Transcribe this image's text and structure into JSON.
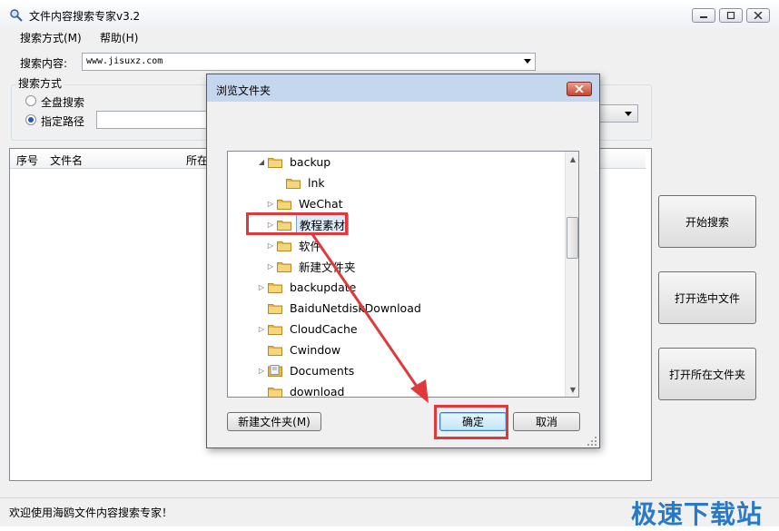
{
  "window": {
    "title": "文件内容搜索专家v3.2",
    "icon": "magnifier-icon"
  },
  "menu": {
    "items": [
      "搜索方式(M)",
      "帮助(H)"
    ]
  },
  "search": {
    "label": "搜索内容:",
    "value": "www.jisuxz.com"
  },
  "mode": {
    "group_title": "搜索方式",
    "options": [
      "全盘搜索",
      "指定路径"
    ],
    "selected": "指定路径"
  },
  "results": {
    "columns": [
      "序号",
      "文件名",
      "所在"
    ]
  },
  "buttons": {
    "start": "开始搜索",
    "open_file": "打开选中文件",
    "open_folder": "打开所在文件夹"
  },
  "status": {
    "text": "欢迎使用海鸥文件内容搜索专家！",
    "watermark": "极速下载站"
  },
  "dialog": {
    "title": "浏览文件夹",
    "tree": [
      {
        "label": "backup",
        "expander": "expanded",
        "icon": "folder-icon"
      },
      {
        "label": "lnk",
        "expander": "none",
        "icon": "folder-icon"
      },
      {
        "label": "WeChat",
        "expander": "collapsed",
        "icon": "folder-icon"
      },
      {
        "label": "教程素材",
        "expander": "collapsed",
        "icon": "folder-icon",
        "selected": true
      },
      {
        "label": "软件",
        "expander": "collapsed",
        "icon": "folder-icon"
      },
      {
        "label": "新建文件夹",
        "expander": "collapsed",
        "icon": "folder-icon"
      },
      {
        "label": "backupdate",
        "expander": "collapsed",
        "icon": "folder-icon"
      },
      {
        "label": "BaiduNetdiskDownload",
        "expander": "none",
        "icon": "folder-icon"
      },
      {
        "label": "CloudCache",
        "expander": "collapsed",
        "icon": "folder-icon"
      },
      {
        "label": "Cwindow",
        "expander": "none",
        "icon": "folder-icon"
      },
      {
        "label": "Documents",
        "expander": "collapsed",
        "icon": "documents-icon"
      },
      {
        "label": "download",
        "expander": "none",
        "icon": "folder-icon"
      }
    ],
    "new_folder": "新建文件夹(M)",
    "ok": "确定",
    "cancel": "取消"
  },
  "colors": {
    "annotation": "#e0393b",
    "watermark": "#2979c7",
    "folder": "#e9b949"
  }
}
